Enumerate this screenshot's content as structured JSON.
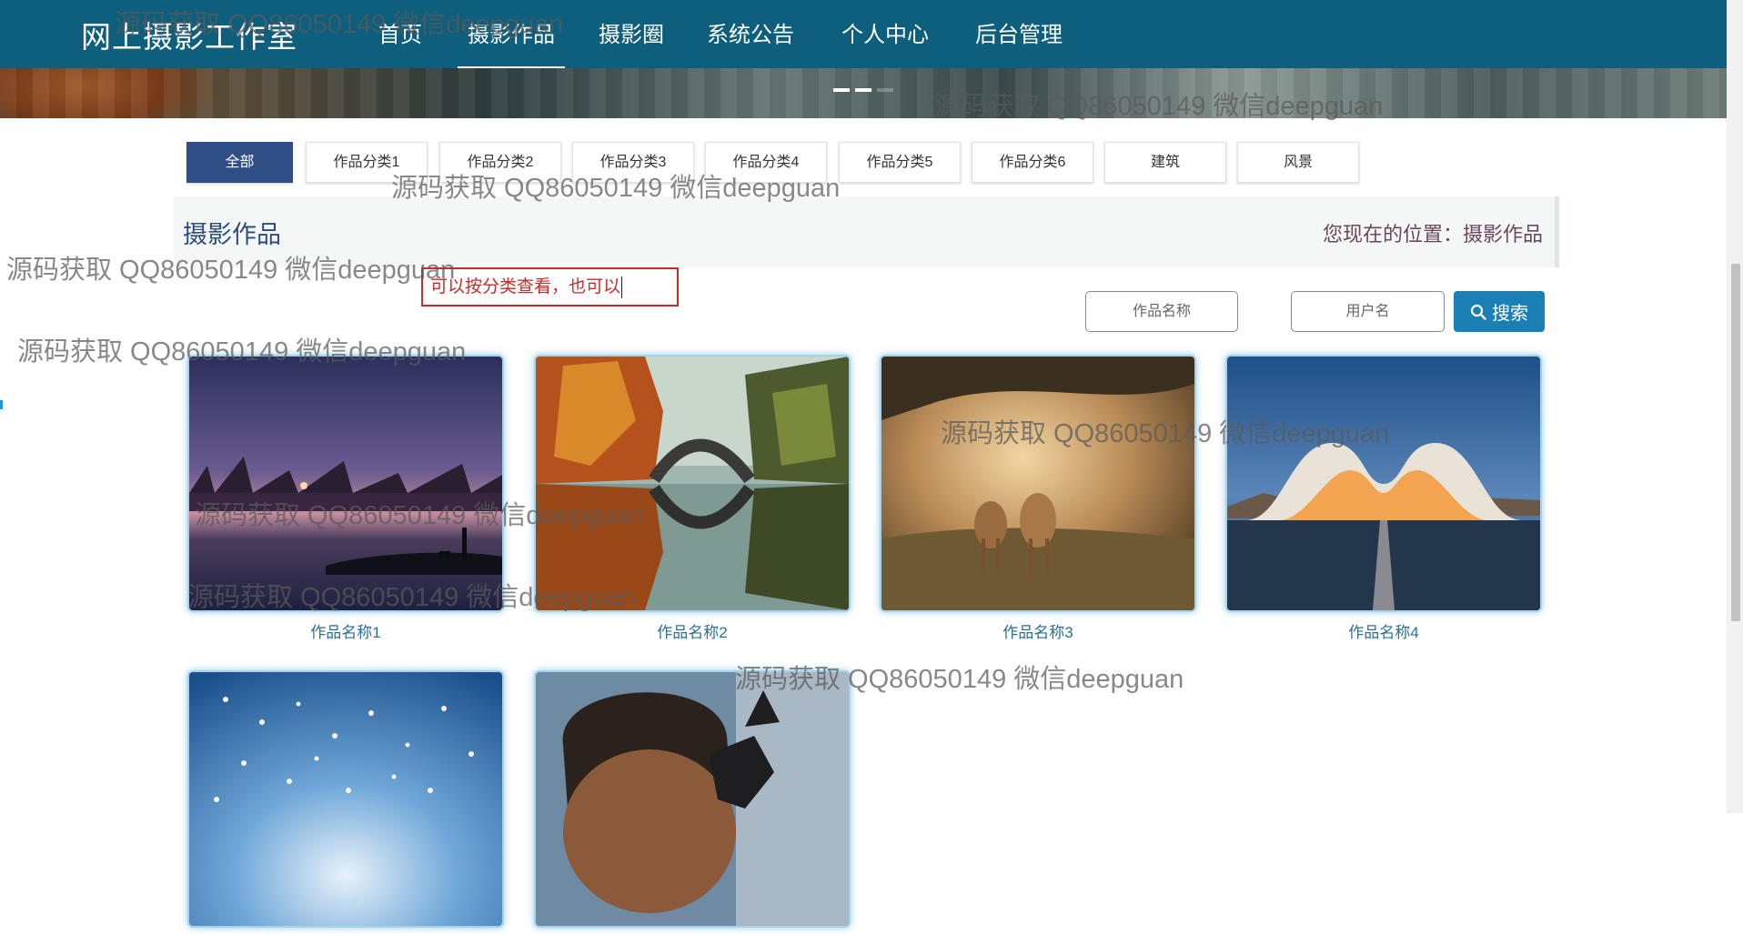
{
  "brand": "网上摄影工作室",
  "nav": [
    {
      "label": "首页",
      "active": false
    },
    {
      "label": "摄影作品",
      "active": true
    },
    {
      "label": "摄影圈",
      "active": false
    },
    {
      "label": "系统公告",
      "active": false
    },
    {
      "label": "个人中心",
      "active": false
    },
    {
      "label": "后台管理",
      "active": false
    }
  ],
  "categories": [
    "全部",
    "作品分类1",
    "作品分类2",
    "作品分类3",
    "作品分类4",
    "作品分类5",
    "作品分类6",
    "建筑",
    "风景"
  ],
  "section": {
    "title": "摄影作品",
    "breadcrumb": "您现在的位置：摄影作品"
  },
  "annotation": "可以按分类查看，也可以",
  "search": {
    "work_name_placeholder": "作品名称",
    "username_placeholder": "用户名",
    "button_label": "搜索"
  },
  "works": [
    {
      "name": "作品名称1",
      "scene": "lake-dusk"
    },
    {
      "name": "作品名称2",
      "scene": "autumn-bridge"
    },
    {
      "name": "作品名称3",
      "scene": "deer"
    },
    {
      "name": "作品名称4",
      "scene": "architecture"
    },
    {
      "name": "",
      "scene": "birds"
    },
    {
      "name": "",
      "scene": "old-man"
    }
  ],
  "watermark": "源码获取 QQ86050149 微信deepguan",
  "colors": {
    "nav_bg": "#0d5f7d",
    "active_category": "#2f4e86",
    "search_button": "#1a7fb5",
    "caption": "#2a6f9b",
    "annotation": "#c92a2a"
  }
}
